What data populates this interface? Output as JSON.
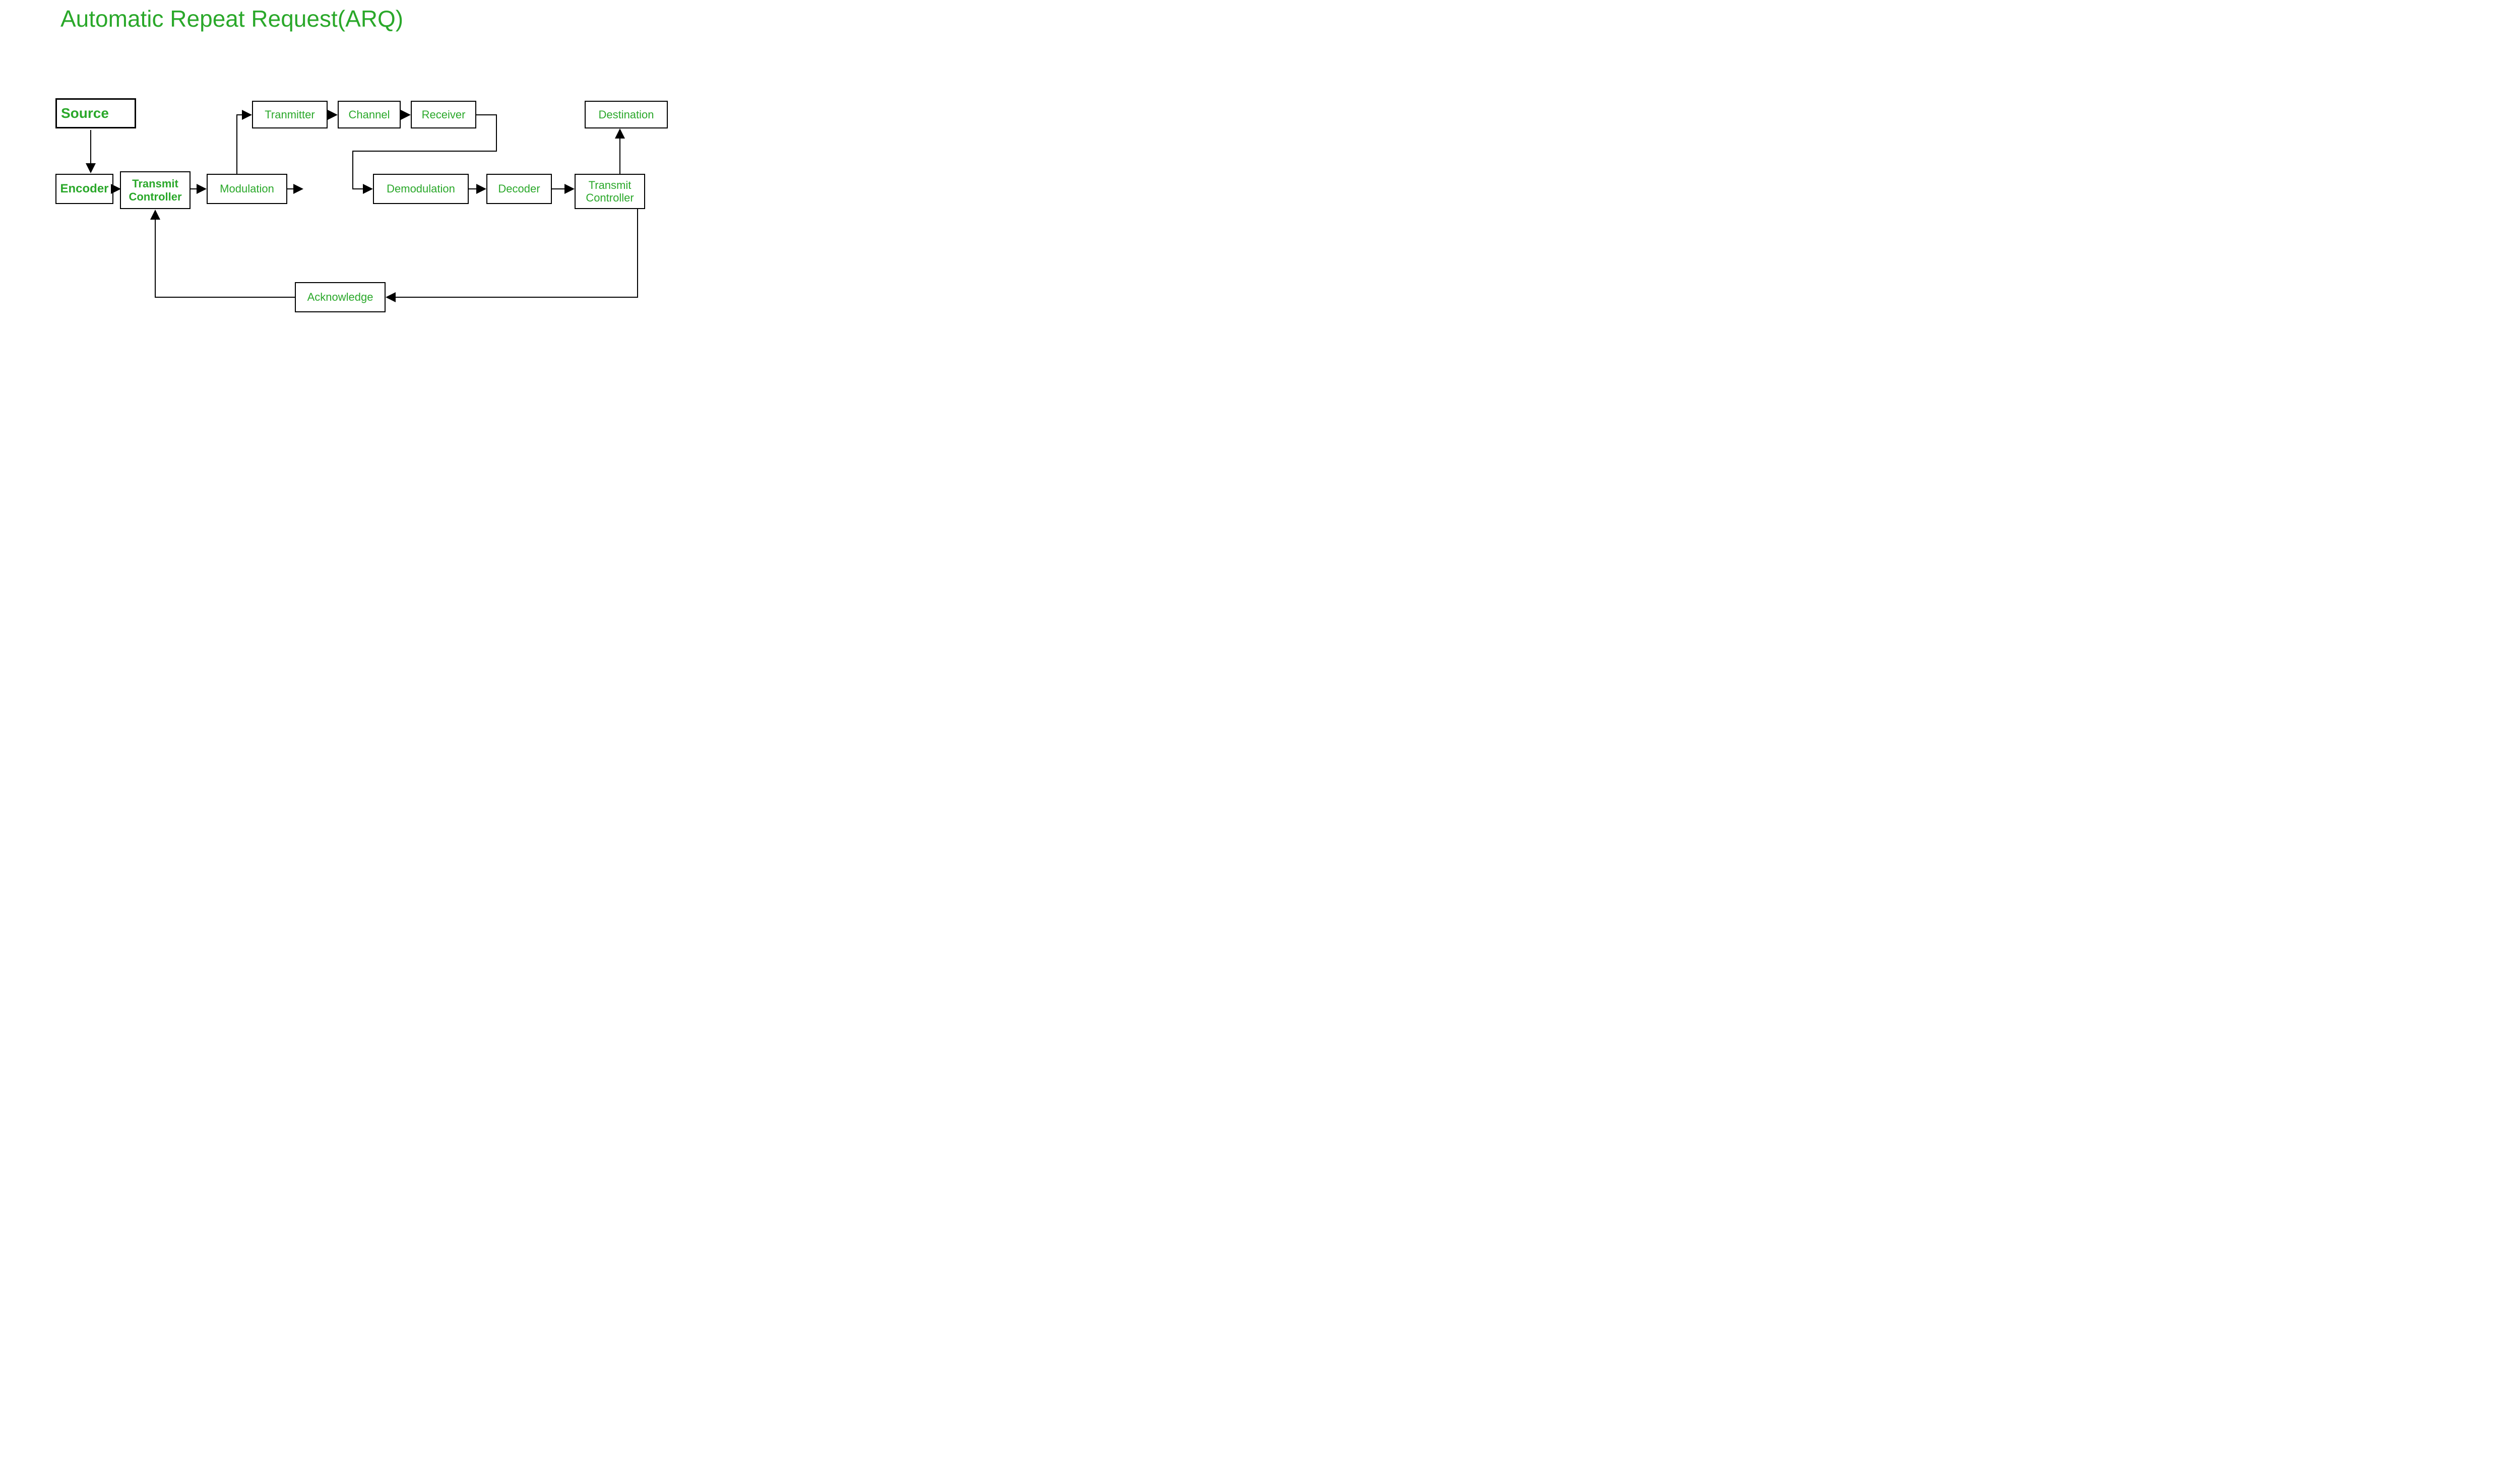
{
  "title": "Automatic Repeat Request(ARQ)",
  "nodes": {
    "source": "Source",
    "encoder": "Encoder",
    "txctrl1": "Transmit Controller",
    "modulation": "Modulation",
    "transmitter": "Tranmitter",
    "channel": "Channel",
    "receiver": "Receiver",
    "demodulation": "Demodulation",
    "decoder": "Decoder",
    "txctrl2": "Transmit Controller",
    "destination": "Destination",
    "acknowledge": "Acknowledge"
  }
}
